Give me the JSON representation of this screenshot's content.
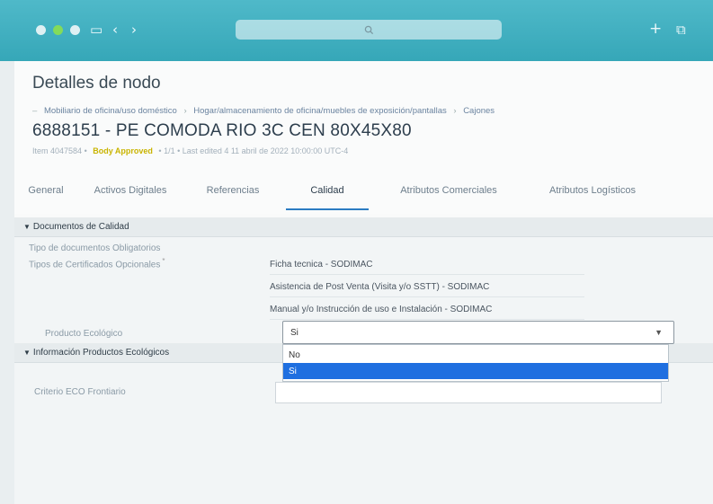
{
  "browser": {
    "nav_back_icon": "chevron-left-icon",
    "nav_forward_icon": "chevron-right-icon",
    "sidebar_icon": "sidebar-icon",
    "search_icon": "search-icon",
    "new_tab": "+",
    "copy_icon": "copy-icon"
  },
  "header": {
    "title": "Detalles de nodo",
    "breadcrumb": [
      "Mobiliario de oficina/uso doméstico",
      "Hogar/almacenamiento de oficina/muebles de exposición/pantallas",
      "Cajones"
    ],
    "product_title": "6888151 - PE COMODA RIO 3C CEN 80X45X80",
    "meta": {
      "id": "Item 4047584",
      "status": "Body Approved",
      "version": "1/1",
      "updated": "Last edited 4 11 abril de 2022 10:00:00 UTC-4"
    }
  },
  "tabs": [
    {
      "label": "General"
    },
    {
      "label": "Activos Digitales"
    },
    {
      "label": "Referencias"
    },
    {
      "label": "Calidad"
    },
    {
      "label": "Atributos Comerciales"
    },
    {
      "label": "Atributos Logísticos"
    }
  ],
  "docs_section": {
    "title": "Documentos de Calidad",
    "label_mandatory": "Tipo de documentos Obligatorios",
    "label_optional": "Tipos de Certificados Opcionales",
    "certificates": [
      "Ficha tecnica - SODIMAC",
      "Asistencia de Post Venta (Visita y/o SSTT) - SODIMAC",
      "Manual y/o Instrucción de uso e Instalación - SODIMAC"
    ]
  },
  "eco_section": {
    "title": "Información Productos Ecológicos",
    "label_product": "Producto Ecológico",
    "selected_value": "Si",
    "options": [
      "No",
      "Si"
    ],
    "label_eco": "Criterio ECO Frontiario"
  },
  "colors": {
    "accent": "#2b7cc2",
    "chrome": "#3fb0c0",
    "selected_option": "#1f6fe0",
    "status": "#c9b400"
  }
}
